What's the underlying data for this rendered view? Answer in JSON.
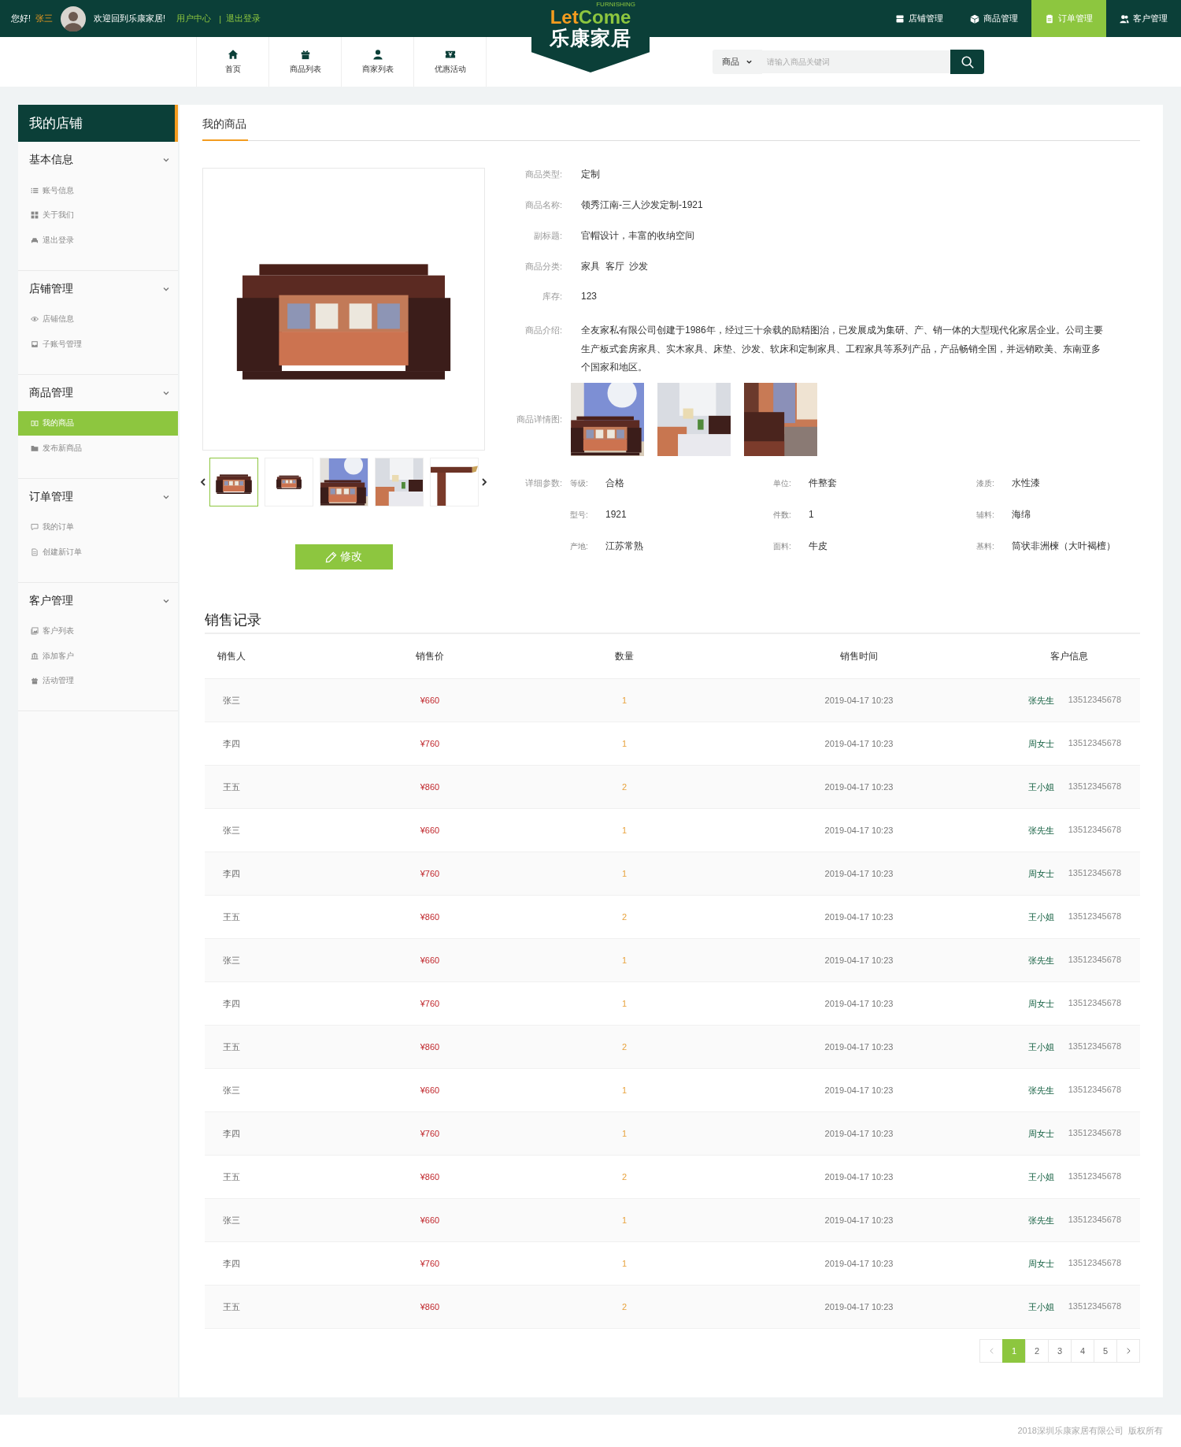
{
  "top_bar": {
    "greeting": "您好!",
    "user_name": "张三",
    "welcome": "欢迎回到乐康家居!",
    "links": [
      "用户中心",
      "退出登录"
    ],
    "separator": "|",
    "menu": [
      {
        "label": "店铺管理",
        "selected": false
      },
      {
        "label": "商品管理",
        "selected": false
      },
      {
        "label": "订单管理",
        "selected": true
      },
      {
        "label": "客户管理",
        "selected": false
      }
    ]
  },
  "logo": {
    "wordmark": [
      "Let",
      "Come"
    ],
    "tagline": "FURNISHING",
    "name": "乐康家居"
  },
  "nav": {
    "items": [
      {
        "label": "首页"
      },
      {
        "label": "商品列表"
      },
      {
        "label": "商家列表"
      },
      {
        "label": "优惠活动"
      }
    ]
  },
  "search": {
    "category": "商品",
    "placeholder": "请输入商品关键词"
  },
  "sidebar": {
    "title": "我的店铺",
    "groups": [
      {
        "title": "基本信息",
        "expanded": true,
        "items": [
          {
            "label": "账号信息",
            "selected": false
          },
          {
            "label": "关于我们",
            "selected": false
          },
          {
            "label": "退出登录",
            "selected": false
          }
        ]
      },
      {
        "title": "店铺管理",
        "expanded": true,
        "items": [
          {
            "label": "店铺信息",
            "selected": false
          },
          {
            "label": "子账号管理",
            "selected": false
          }
        ]
      },
      {
        "title": "商品管理",
        "expanded": true,
        "items": [
          {
            "label": "我的商品",
            "selected": true
          },
          {
            "label": "发布新商品",
            "selected": false
          }
        ]
      },
      {
        "title": "订单管理",
        "expanded": true,
        "items": [
          {
            "label": "我的订单",
            "selected": false
          },
          {
            "label": "创建新订单",
            "selected": false
          }
        ]
      },
      {
        "title": "客户管理",
        "expanded": true,
        "items": [
          {
            "label": "客户列表",
            "selected": false
          },
          {
            "label": "添加客户",
            "selected": false
          },
          {
            "label": "活动管理",
            "selected": false
          }
        ]
      }
    ]
  },
  "product": {
    "section_title": "我的商品",
    "gallery": {
      "main": {
        "kind": "picture"
      },
      "thumbnails": [
        {
          "kind": "picture",
          "selected": true
        },
        {
          "kind": "picture",
          "selected": false
        },
        {
          "kind": "picture",
          "selected": false
        },
        {
          "kind": "picture",
          "selected": false
        },
        {
          "kind": "picture",
          "selected": false
        }
      ]
    },
    "edit_button": "修改",
    "fields": [
      {
        "label": "商品类型:",
        "value": "定制"
      },
      {
        "label": "商品名称:",
        "value": "领秀江南-三人沙发定制-1921"
      },
      {
        "label": "副标题:",
        "value": "官帽设计，丰富的收纳空间"
      },
      {
        "label": "商品分类:",
        "value": "家具  客厅  沙发"
      },
      {
        "label": "库存:",
        "value": "123"
      },
      {
        "label": "商品介绍:",
        "value": "全友家私有限公司创建于1986年，经过三十余载的励精图治，已发展成为集研、产、销一体的大型现代化家居企业。公司主要生产板式套房家具、实木家具、床垫、沙发、软床和定制家具、工程家具等系列产品，产品畅销全国，并远销欧美、东南亚多个国家和地区。"
      }
    ],
    "detail_images": {
      "label": "商品详情图:",
      "images": [
        {
          "kind": "picture"
        },
        {
          "kind": "picture"
        },
        {
          "kind": "picture"
        }
      ]
    },
    "params": {
      "label": "详细参数:",
      "items": [
        {
          "label": "等级:",
          "value": "合格"
        },
        {
          "label": "单位:",
          "value": "件整套"
        },
        {
          "label": "漆质:",
          "value": "水性漆"
        },
        {
          "label": "型号:",
          "value": "1921"
        },
        {
          "label": "件数:",
          "value": "1"
        },
        {
          "label": "辅料:",
          "value": "海绵"
        },
        {
          "label": "产地:",
          "value": "江苏常熟"
        },
        {
          "label": "面料:",
          "value": "牛皮"
        },
        {
          "label": "基料:",
          "value": "筒状非洲楝（大叶褐檀）"
        }
      ]
    }
  },
  "sales": {
    "title": "销售记录",
    "columns": [
      "销售人",
      "销售价",
      "数量",
      "销售时间",
      "客户信息"
    ],
    "rows": [
      {
        "seller": "张三",
        "price": "¥660",
        "quantity": "1",
        "time": "2019-04-17 10:23",
        "customer": "张先生",
        "phone": "13512345678"
      },
      {
        "seller": "李四",
        "price": "¥760",
        "quantity": "1",
        "time": "2019-04-17 10:23",
        "customer": "周女士",
        "phone": "13512345678"
      },
      {
        "seller": "王五",
        "price": "¥860",
        "quantity": "2",
        "time": "2019-04-17 10:23",
        "customer": "王小姐",
        "phone": "13512345678"
      },
      {
        "seller": "张三",
        "price": "¥660",
        "quantity": "1",
        "time": "2019-04-17 10:23",
        "customer": "张先生",
        "phone": "13512345678"
      },
      {
        "seller": "李四",
        "price": "¥760",
        "quantity": "1",
        "time": "2019-04-17 10:23",
        "customer": "周女士",
        "phone": "13512345678"
      },
      {
        "seller": "王五",
        "price": "¥860",
        "quantity": "2",
        "time": "2019-04-17 10:23",
        "customer": "王小姐",
        "phone": "13512345678"
      },
      {
        "seller": "张三",
        "price": "¥660",
        "quantity": "1",
        "time": "2019-04-17 10:23",
        "customer": "张先生",
        "phone": "13512345678"
      },
      {
        "seller": "李四",
        "price": "¥760",
        "quantity": "1",
        "time": "2019-04-17 10:23",
        "customer": "周女士",
        "phone": "13512345678"
      },
      {
        "seller": "王五",
        "price": "¥860",
        "quantity": "2",
        "time": "2019-04-17 10:23",
        "customer": "王小姐",
        "phone": "13512345678"
      },
      {
        "seller": "张三",
        "price": "¥660",
        "quantity": "1",
        "time": "2019-04-17 10:23",
        "customer": "张先生",
        "phone": "13512345678"
      },
      {
        "seller": "李四",
        "price": "¥760",
        "quantity": "1",
        "time": "2019-04-17 10:23",
        "customer": "周女士",
        "phone": "13512345678"
      },
      {
        "seller": "王五",
        "price": "¥860",
        "quantity": "2",
        "time": "2019-04-17 10:23",
        "customer": "王小姐",
        "phone": "13512345678"
      },
      {
        "seller": "张三",
        "price": "¥660",
        "quantity": "1",
        "time": "2019-04-17 10:23",
        "customer": "张先生",
        "phone": "13512345678"
      },
      {
        "seller": "李四",
        "price": "¥760",
        "quantity": "1",
        "time": "2019-04-17 10:23",
        "customer": "周女士",
        "phone": "13512345678"
      },
      {
        "seller": "王五",
        "price": "¥860",
        "quantity": "2",
        "time": "2019-04-17 10:23",
        "customer": "王小姐",
        "phone": "13512345678"
      }
    ],
    "pagination": {
      "pages": [
        {
          "label": "1",
          "selected": true
        },
        {
          "label": "2",
          "selected": false
        },
        {
          "label": "3",
          "selected": false
        },
        {
          "label": "4",
          "selected": false
        },
        {
          "label": "5",
          "selected": false
        }
      ]
    }
  },
  "footer": {
    "copyright": "2018深圳乐康家居有限公司  版权所有"
  }
}
